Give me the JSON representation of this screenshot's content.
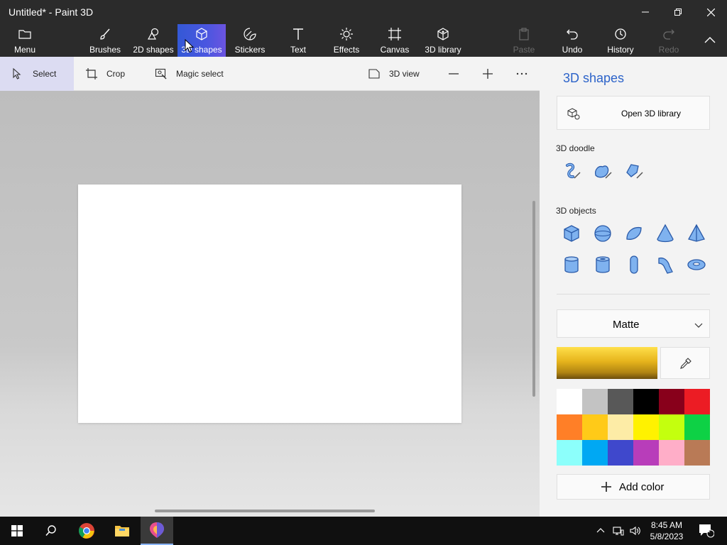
{
  "window": {
    "title": "Untitled* - Paint 3D"
  },
  "ribbon": {
    "menu": "Menu",
    "brushes": "Brushes",
    "shapes2d": "2D shapes",
    "shapes3d": "3D shapes",
    "stickers": "Stickers",
    "text": "Text",
    "effects": "Effects",
    "canvas": "Canvas",
    "library3d": "3D library",
    "paste": "Paste",
    "undo": "Undo",
    "history": "History",
    "redo": "Redo"
  },
  "toolbar": {
    "select": "Select",
    "crop": "Crop",
    "magic_select": "Magic select",
    "view3d": "3D view"
  },
  "panel": {
    "title": "3D shapes",
    "open_library": "Open 3D library",
    "doodle_label": "3D doodle",
    "objects_label": "3D objects",
    "material": "Matte",
    "current_color": "#d9a821",
    "add_color": "Add color",
    "palette": [
      "#ffffff",
      "#c3c3c3",
      "#585858",
      "#000000",
      "#88001b",
      "#ec1c24",
      "#ff7f27",
      "#ffca18",
      "#fdeca6",
      "#fff200",
      "#c4ff0e",
      "#0ed145",
      "#8cfffb",
      "#00a8f3",
      "#3f48cc",
      "#b83dba",
      "#ffaec8",
      "#b97a56"
    ]
  },
  "taskbar": {
    "time": "8:45 AM",
    "date": "5/8/2023",
    "notifications": "1"
  }
}
